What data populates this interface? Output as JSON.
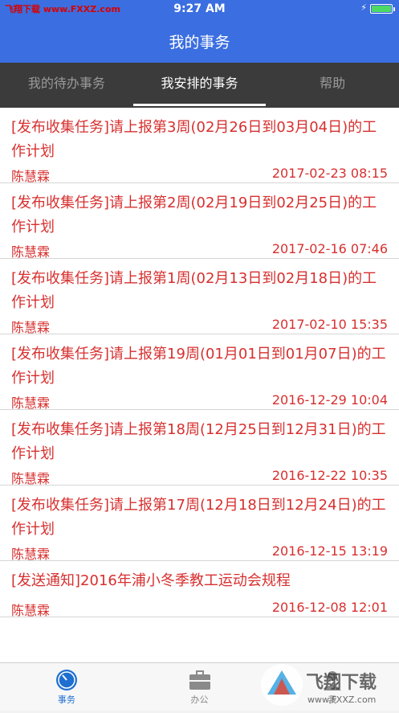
{
  "status": {
    "carrier": "飞翔下载 www.FXXZ.com",
    "time": "9:27 AM",
    "battery_level": 1.0
  },
  "navbar": {
    "title": "我的事务"
  },
  "tabs": [
    {
      "label": "我的待办事务"
    },
    {
      "label": "我安排的事务"
    },
    {
      "label": "帮助"
    }
  ],
  "items": [
    {
      "title": "[发布收集任务]请上报第3周(02月26日到03月04日)的工作计划",
      "author": "陈慧霖",
      "date": "2017-02-23 08:15"
    },
    {
      "title": "[发布收集任务]请上报第2周(02月19日到02月25日)的工作计划",
      "author": "陈慧霖",
      "date": "2017-02-16 07:46"
    },
    {
      "title": "[发布收集任务]请上报第1周(02月13日到02月18日)的工作计划",
      "author": "陈慧霖",
      "date": "2017-02-10 15:35"
    },
    {
      "title": "[发布收集任务]请上报第19周(01月01日到01月07日)的工作计划",
      "author": "陈慧霖",
      "date": "2016-12-29 10:04"
    },
    {
      "title": "[发布收集任务]请上报第18周(12月25日到12月31日)的工作计划",
      "author": "陈慧霖",
      "date": "2016-12-22 10:35"
    },
    {
      "title": "[发布收集任务]请上报第17周(12月18日到12月24日)的工作计划",
      "author": "陈慧霖",
      "date": "2016-12-15 13:19"
    },
    {
      "title": "[发送通知]2016年浦小冬季教工运动会规程",
      "author": "陈慧霖",
      "date": "2016-12-08 12:01"
    }
  ],
  "bottom_tabs": [
    {
      "label": "事务",
      "icon": "clock-icon"
    },
    {
      "label": "办公",
      "icon": "briefcase-icon"
    },
    {
      "label": "我",
      "icon": "person-icon"
    }
  ],
  "watermark": {
    "text": "飞翔下载",
    "url": "www.FXXZ.com"
  },
  "colors": {
    "nav_blue": "#3b6ee0",
    "tab_dark": "#3b3b3b",
    "item_red": "#d6302f",
    "active_blue": "#1f6fd1"
  }
}
